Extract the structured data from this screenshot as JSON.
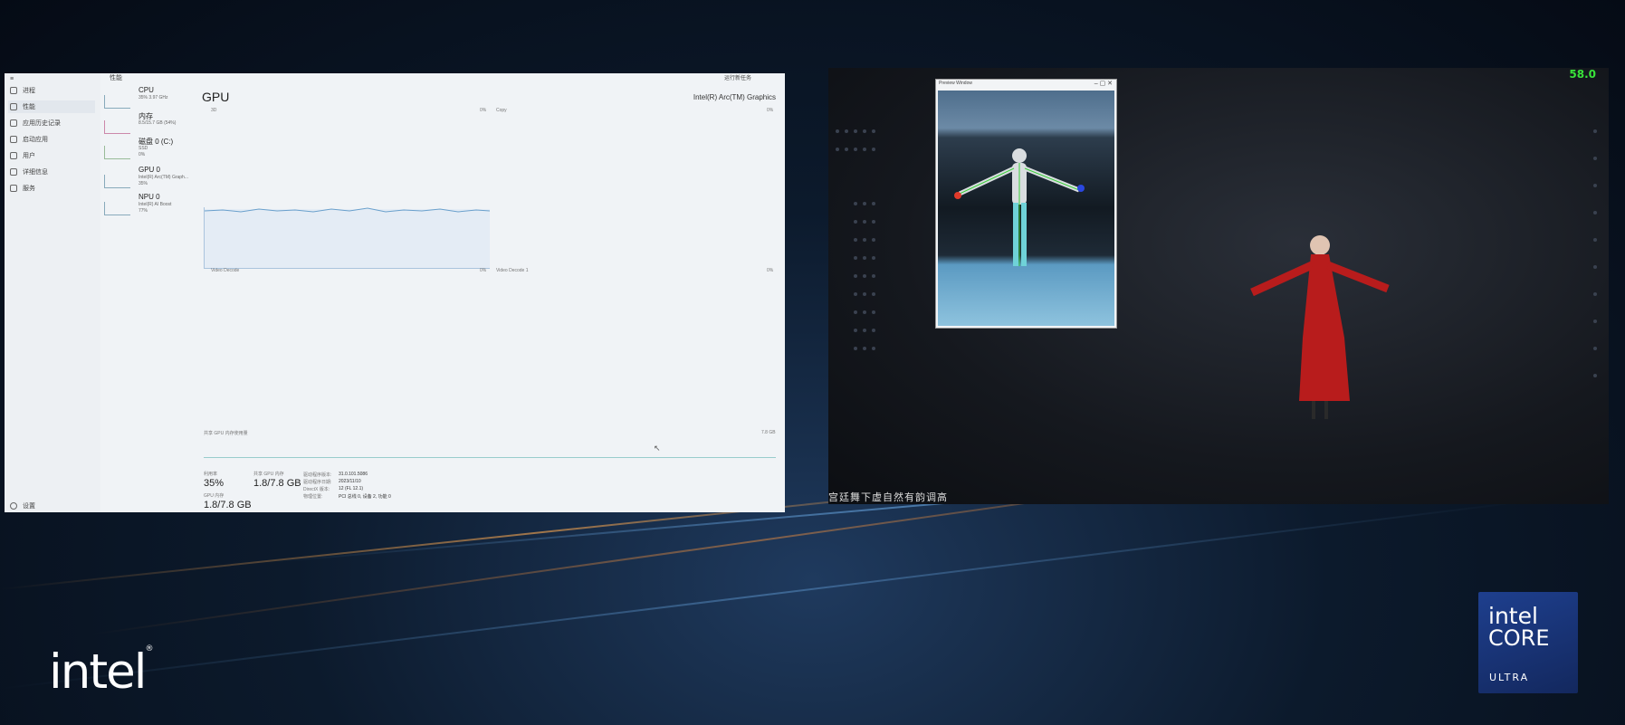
{
  "task_manager": {
    "header_section": "性能",
    "header_right": "运行新任务",
    "nav_items": [
      {
        "label": "进程",
        "icon": "grid-icon"
      },
      {
        "label": "性能",
        "icon": "chart-icon"
      },
      {
        "label": "应用历史记录",
        "icon": "history-icon"
      },
      {
        "label": "启动应用",
        "icon": "rocket-icon"
      },
      {
        "label": "用户",
        "icon": "users-icon"
      },
      {
        "label": "详细信息",
        "icon": "list-icon"
      },
      {
        "label": "服务",
        "icon": "gear-icon"
      }
    ],
    "nav_footer": "设置",
    "perf_items": [
      {
        "title": "CPU",
        "sub": "35%  3.97 GHz",
        "sub2": ""
      },
      {
        "title": "内存",
        "sub": "8.5/15.7 GB (54%)",
        "sub2": ""
      },
      {
        "title": "磁盘 0 (C:)",
        "sub": "SSD",
        "sub2": "0%"
      },
      {
        "title": "GPU 0",
        "sub": "Intel(R) Arc(TM) Graph...",
        "sub2": "35%"
      },
      {
        "title": "NPU 0",
        "sub": "Intel(R) AI Boost",
        "sub2": "77%"
      }
    ],
    "gpu_title": "GPU",
    "gpu_name": "Intel(R) Arc(TM) Graphics",
    "graph_labels": {
      "g3d": "3D",
      "g3d_pct": "0%",
      "copy": "Copy",
      "copy_pct": "0%",
      "vdec": "Video Decode",
      "vdec_pct": "0%",
      "vdec1": "Video Decode 1",
      "vdec1_pct": "0%",
      "shared_label": "共享 GPU 内存使用量",
      "shared_max": "7.8 GB"
    },
    "stats": {
      "util_label": "利用率",
      "util_value": "35%",
      "shared_label": "共享 GPU 内存",
      "shared_value": "1.8/7.8 GB",
      "gpu_mem_label": "GPU 内存",
      "gpu_mem_value": "1.8/7.8 GB",
      "driver_version_label": "驱动程序版本:",
      "driver_version": "31.0.101.5086",
      "driver_date_label": "驱动程序日期:",
      "driver_date": "2023/11/10",
      "directx_label": "DirectX 版本:",
      "directx": "12 (FL 12.1)",
      "location_label": "物理位置:",
      "location": "PCI 总线 0, 设备 2, 功能 0"
    }
  },
  "video": {
    "fps": "58.0",
    "cam_window_title": "Preview Window",
    "subtitle": "宫廷舞下虚自然有韵调高"
  },
  "branding": {
    "intel": "intel",
    "core_line1": "intel",
    "core_line2": "CORE",
    "core_line3": "ULTRA"
  }
}
